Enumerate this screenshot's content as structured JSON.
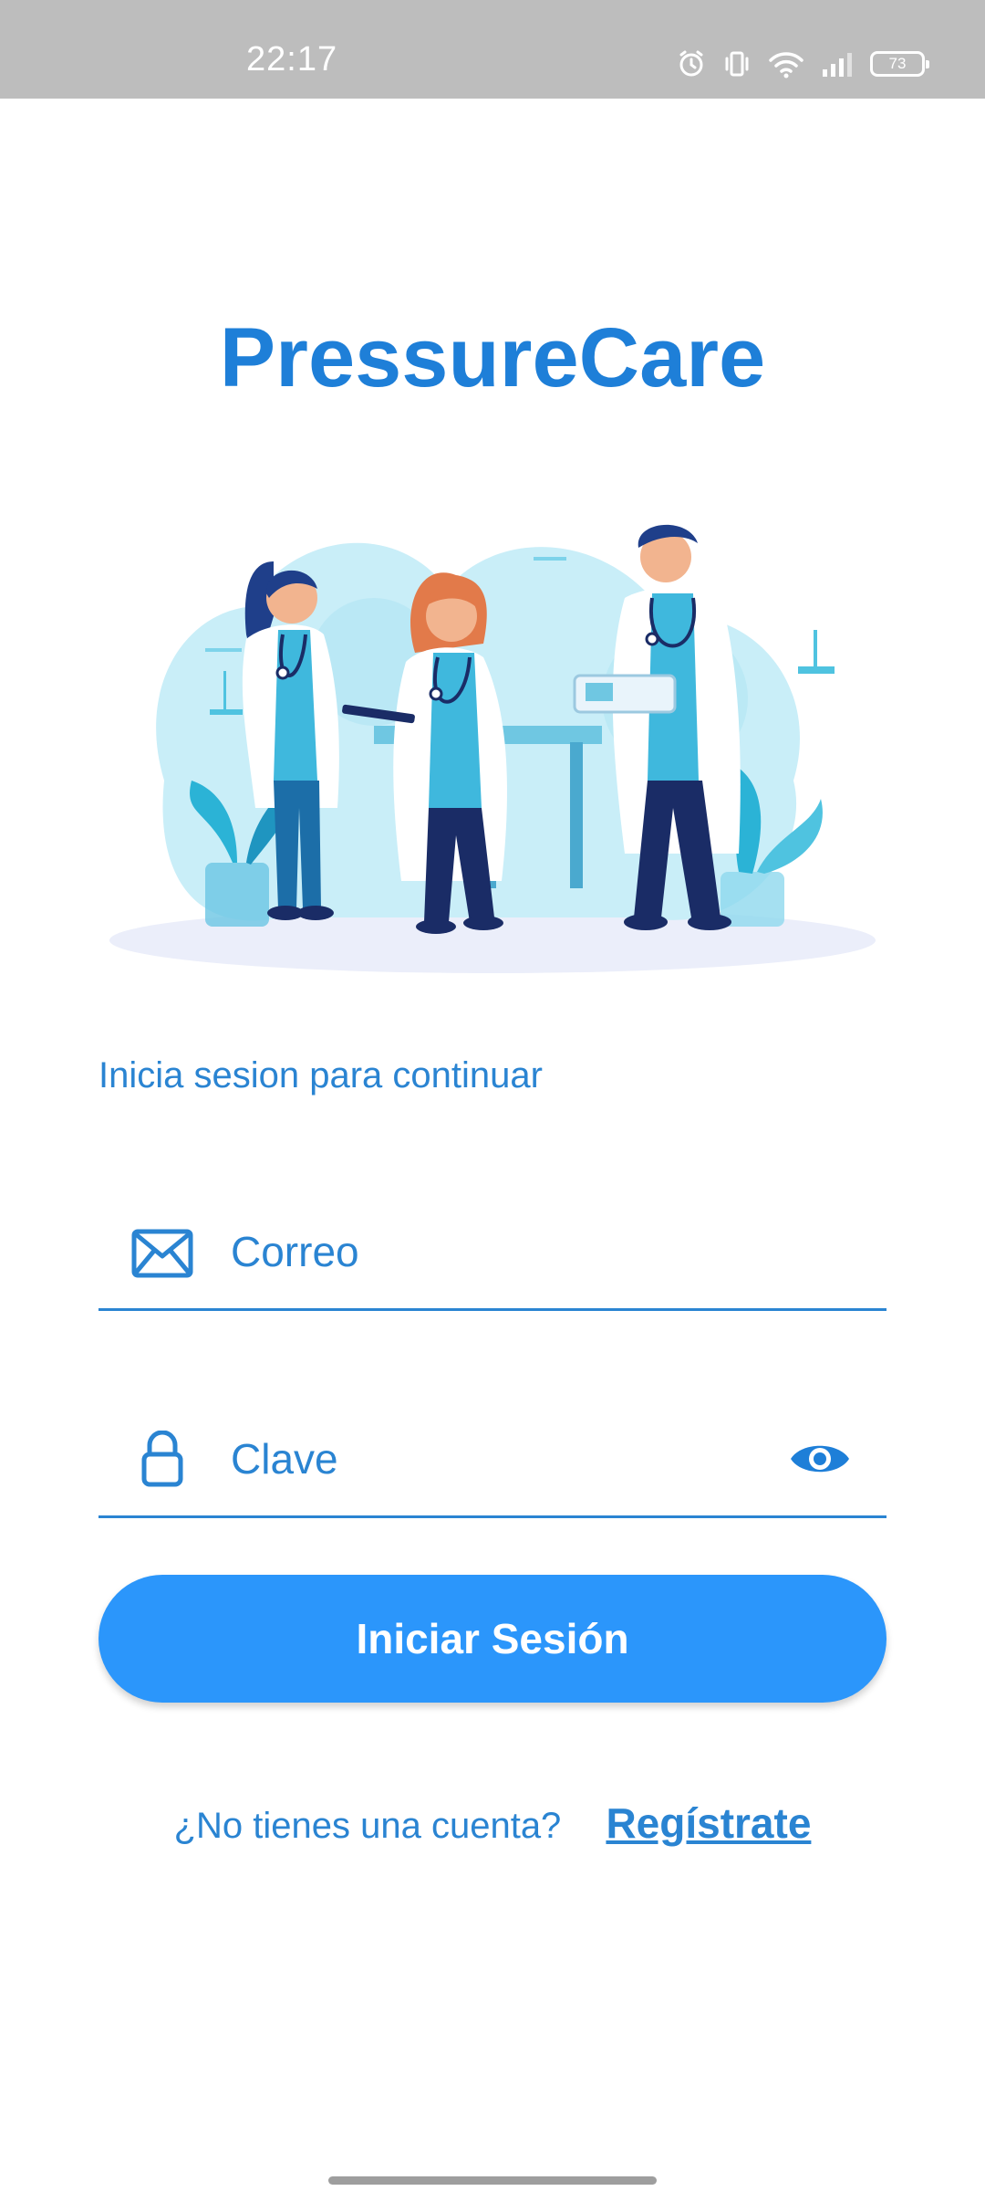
{
  "status_bar": {
    "time": "22:17",
    "battery": "73"
  },
  "app": {
    "title": "PressureCare"
  },
  "login": {
    "subtitle": "Inicia sesion para continuar",
    "email_label": "Correo",
    "password_label": "Clave",
    "submit_label": "Iniciar Sesión",
    "no_account_text": "¿No tienes una cuenta?",
    "register_link": "Regístrate"
  },
  "icons": {
    "email": "envelope-icon",
    "password": "lock-icon",
    "toggle": "eye-icon"
  },
  "colors": {
    "accent": "#1e7fd8",
    "button": "#2b96fb",
    "status_bar": "#bdbdbd"
  }
}
